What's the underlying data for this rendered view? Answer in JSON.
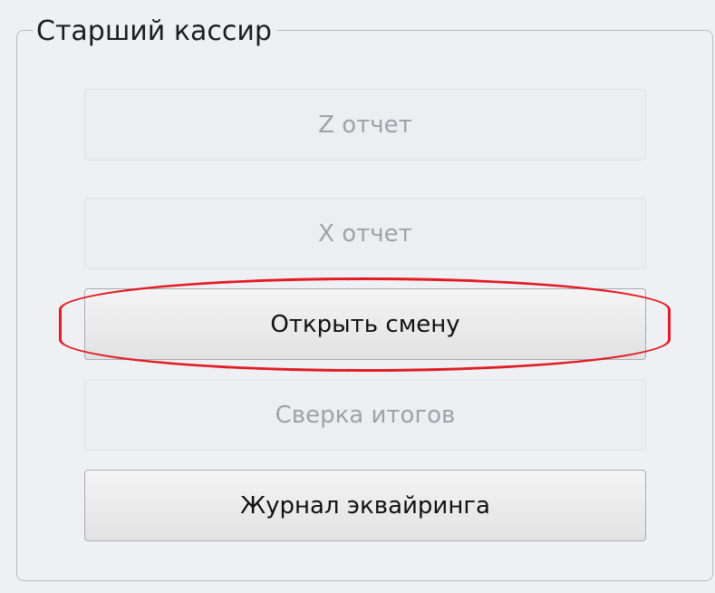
{
  "groupbox": {
    "title": "Старший кассир"
  },
  "buttons": {
    "z_report": {
      "label": "Z отчет",
      "enabled": false
    },
    "x_report": {
      "label": "X отчет",
      "enabled": false
    },
    "open_shift": {
      "label": "Открыть смену",
      "enabled": true,
      "highlighted": true
    },
    "reconcile_totals": {
      "label": "Сверка итогов",
      "enabled": false
    },
    "acquiring_journal": {
      "label": "Журнал эквайринга",
      "enabled": true
    }
  },
  "colors": {
    "highlight": "#e11c24",
    "enabled_text": "#111111",
    "disabled_text": "#9ea3a9",
    "background": "#eef0f4"
  }
}
